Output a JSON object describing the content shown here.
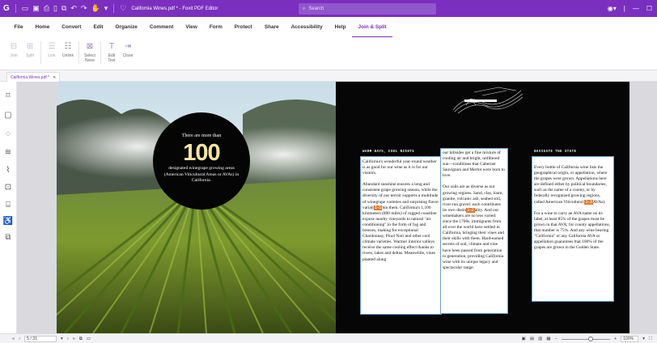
{
  "titlebar": {
    "title": "California Wines.pdf * - Foxit PDF Editor",
    "search_placeholder": "Search"
  },
  "menu": [
    "File",
    "Home",
    "Convert",
    "Edit",
    "Organize",
    "Comment",
    "View",
    "Form",
    "Protect",
    "Share",
    "Accessibility",
    "Help",
    "Join & Split"
  ],
  "ribbon": {
    "buttons": [
      {
        "label": "Join",
        "icon": "join-icon"
      },
      {
        "label": "Split",
        "icon": "split-icon"
      },
      {
        "label": "Link",
        "icon": "link-icon"
      },
      {
        "label": "Unlink",
        "icon": "unlink-icon"
      },
      {
        "label": "Select None",
        "icon": "select-none-icon"
      },
      {
        "label": "Edit Text",
        "icon": "edit-text-icon"
      },
      {
        "label": "Close",
        "icon": "close-icon"
      }
    ]
  },
  "doc_tab": {
    "label": "California Wines.pdf *"
  },
  "left_page": {
    "circle_top": "There are more than",
    "circle_number": "100",
    "circle_sub": "designated winegrape growing areas (American Viticultural Areas or AVAs) in California."
  },
  "right_page": {
    "art_caption": "",
    "col1_head": "WARM DAYS, COOL NIGHTS",
    "col1_p1": "California's wonderful year-round weather is as good for our wine as it is for our visitors.",
    "col1_p2_a": "Abundant sunshine ensures a long and consistent grape growing season, while the diversity of our terroir supports a multitude of winegrape varieties and surprising flavor variati",
    "col1_mark": "1-1",
    "col1_p2_b": "hin them. California's 1,100 kilometers (800 miles) of rugged coastline expose nearby vineyards to natural \"air conditioning\" in the form of fog and breezes, making for exceptional Chardonnay, Pinot Noir and other cool climate varieties. Warmer interior valleys receive the same cooling effect thanks to rivers, lakes and deltas. Meanwhile, vines planted along",
    "col2_p1": "our hillsides get a fine mixture of cooling air and bright, unfiltered sun—conditions that Cabernet Sauvignon and Merlot were born to love.",
    "col2_p2_a": "Our soils are as diverse as our growing regions. Sand, clay, loam, granite, volcanic ash, seabed soil, river-run gravel: each contributes its own distin",
    "col2_mark": "1-2",
    "col2_p2_b": "ality. And our winemakers are no less varied: since the 1700s, immigrants from all over the world have settled in California, bringing their vines and their skills with them. Hard-earned secrets of soil, climate and vine have been passed from generation to generation, providing California wine with its unique legacy and spectacular range.",
    "col3_head": "NAVIGATE THE STATE",
    "col3_p1_a": "Every bottle of California wine lists the geographical origin, or appellation, where the grapes were grown. Appellations here are defined either by political boundaries, such as the name of a county, or by federally recognized growing regions, called American Viticultural",
    "col3_mark": "1-3",
    "col3_p1_b": "AVAs).",
    "col3_p2": "For a wine to carry an AVA name on its label, at least 85% of the grapes must be grown in that AVA; for county appellations, that number is 75%. And any wine bearing \"California\" or any California AVA or appellation guarantees that 100% of the grapes are grown in the Golden State."
  },
  "statusbar": {
    "page_value": "5 / 31",
    "zoom_value": "100%",
    "zoom_level_fraction": 0.6
  },
  "colors": {
    "accent": "#7b2fbe",
    "mark": "#e07a2e"
  }
}
